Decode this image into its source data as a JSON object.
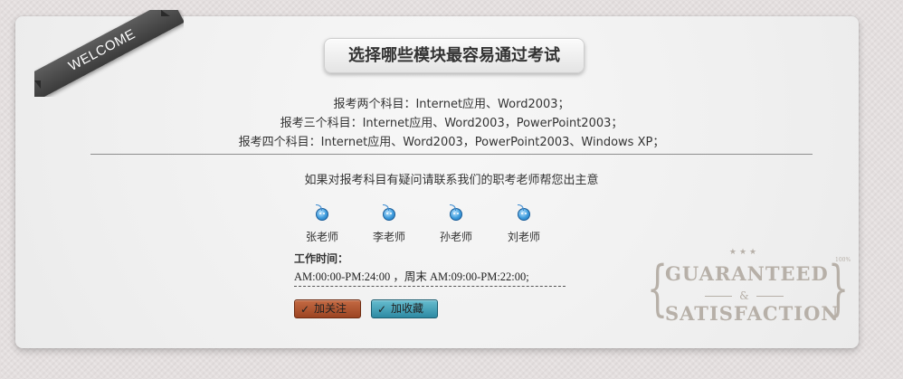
{
  "ribbon": {
    "label": "WELCOME"
  },
  "title": "选择哪些模块最容易通过考试",
  "subjects": [
    "报考两个科目：Internet应用、Word2003；",
    "报考三个科目：Internet应用、Word2003，PowerPoint2003；",
    "报考四个科目：Internet应用、Word2003，PowerPoint2003、Windows XP；"
  ],
  "contact_prompt": "如果对报考科目有疑问请联系我们的职考老师帮您出主意",
  "teachers": [
    {
      "name": "张老师",
      "icon": "qq-penguin-icon"
    },
    {
      "name": "李老师",
      "icon": "qq-penguin-icon"
    },
    {
      "name": "孙老师",
      "icon": "qq-penguin-icon"
    },
    {
      "name": "刘老师",
      "icon": "qq-penguin-icon"
    }
  ],
  "worktime": {
    "label": "工作时间：",
    "hours": "AM:00:00-PM:24:00 ，周末 AM:09:00-PM:22:00;"
  },
  "buttons": {
    "follow": "加关注",
    "favorite": "加收藏",
    "check_icon": "check-icon"
  },
  "stamp": {
    "stars": "★★★",
    "line1": "GUARANTEED",
    "ampersand": "&",
    "line2": "SATISFACTION",
    "percent": "100%"
  },
  "colors": {
    "follow_button": "#b45a35",
    "favorite_button": "#4aa3ba",
    "ribbon": "#4a4a4a",
    "stamp": "#b7b0a8"
  }
}
